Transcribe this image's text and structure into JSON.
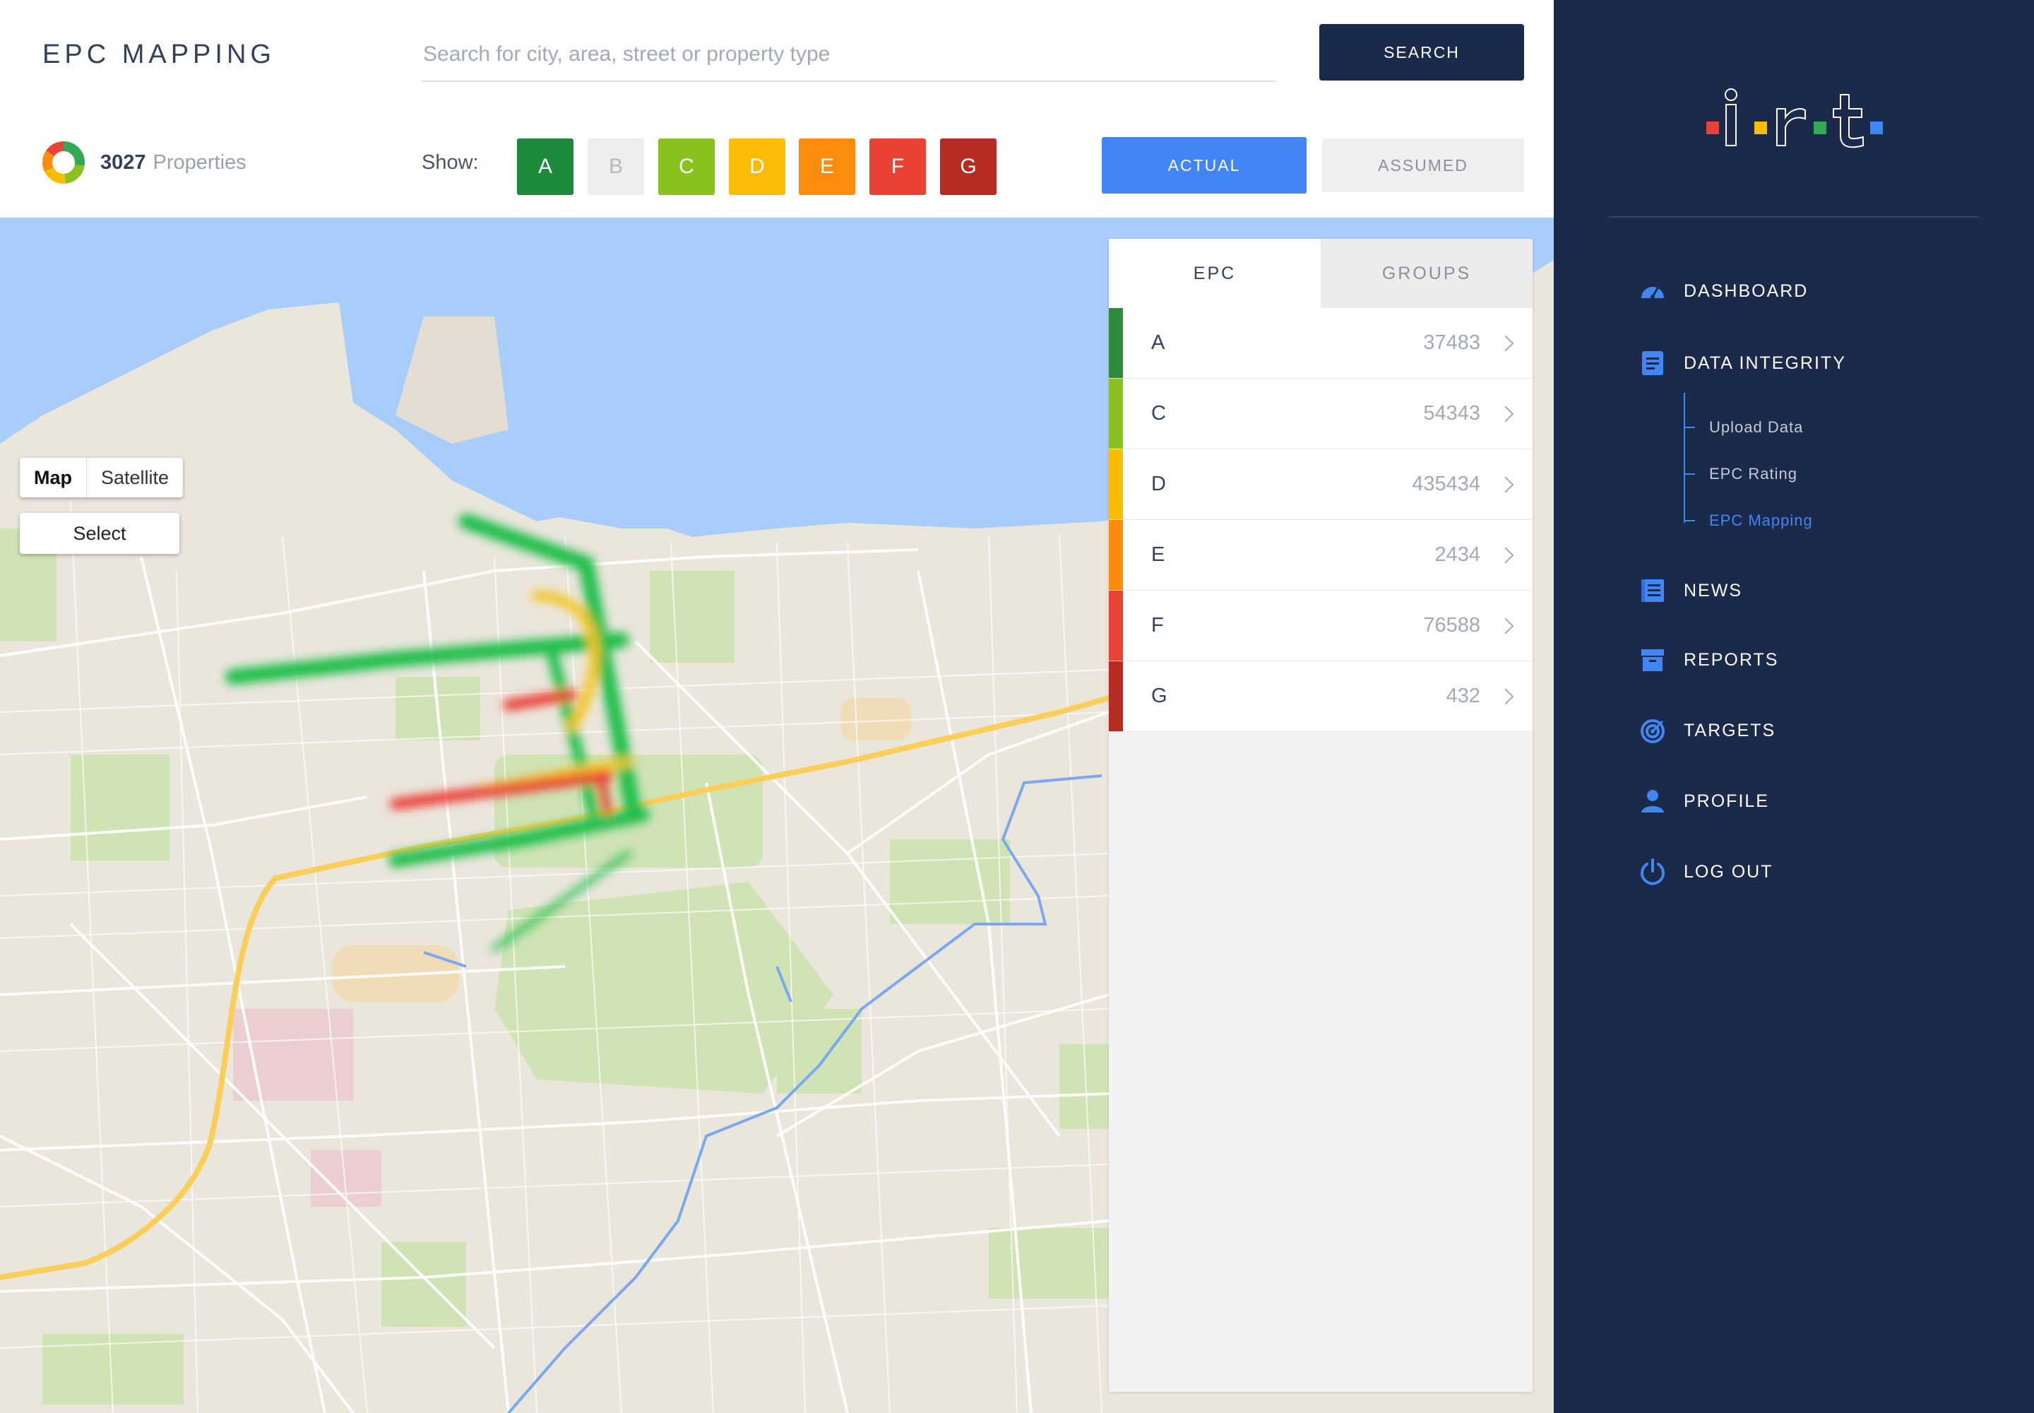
{
  "header": {
    "title": "EPC MAPPING",
    "search_placeholder": "Search for city, area, street or property type",
    "search_value": "",
    "search_button": "SEARCH",
    "property_count": "3027",
    "property_label": "Properties",
    "show_label": "Show:",
    "filters": [
      {
        "label": "A",
        "color": "#1e8a3c",
        "active": true
      },
      {
        "label": "B",
        "color": "#eeeeee",
        "active": false
      },
      {
        "label": "C",
        "color": "#8bc11f",
        "active": true
      },
      {
        "label": "D",
        "color": "#fbbc05",
        "active": true
      },
      {
        "label": "E",
        "color": "#fb8c0e",
        "active": true
      },
      {
        "label": "F",
        "color": "#ea4335",
        "active": true
      },
      {
        "label": "G",
        "color": "#b62b22",
        "active": true
      }
    ],
    "mode_actual": "ACTUAL",
    "mode_assumed": "ASSUMED"
  },
  "map": {
    "type_map": "Map",
    "type_satellite": "Satellite",
    "select": "Select"
  },
  "panel": {
    "tab_epc": "EPC",
    "tab_groups": "GROUPS",
    "ratings": [
      {
        "letter": "A",
        "value": "37483",
        "color": "#2e8b3e"
      },
      {
        "letter": "C",
        "value": "54343",
        "color": "#8bc11f"
      },
      {
        "letter": "D",
        "value": "435434",
        "color": "#fbbc05"
      },
      {
        "letter": "E",
        "value": "2434",
        "color": "#fb8c0e"
      },
      {
        "letter": "F",
        "value": "76588",
        "color": "#ea4335"
      },
      {
        "letter": "G",
        "value": "432",
        "color": "#b62b22"
      }
    ]
  },
  "sidebar": {
    "logo_colors": [
      "#ea4335",
      "#fbbc05",
      "#34a853",
      "#4285f4"
    ],
    "items": [
      {
        "label": "DASHBOARD",
        "icon": "speedometer-icon"
      },
      {
        "label": "DATA INTEGRITY",
        "icon": "document-icon"
      },
      {
        "label": "NEWS",
        "icon": "news-icon"
      },
      {
        "label": "REPORTS",
        "icon": "archive-box-icon"
      },
      {
        "label": "TARGETS",
        "icon": "target-icon"
      },
      {
        "label": "PROFILE",
        "icon": "user-icon"
      },
      {
        "label": "LOG OUT",
        "icon": "power-icon"
      }
    ],
    "subitems": [
      {
        "label": "Upload Data",
        "active": false
      },
      {
        "label": "EPC Rating",
        "active": false
      },
      {
        "label": "EPC Mapping",
        "active": true
      }
    ]
  }
}
